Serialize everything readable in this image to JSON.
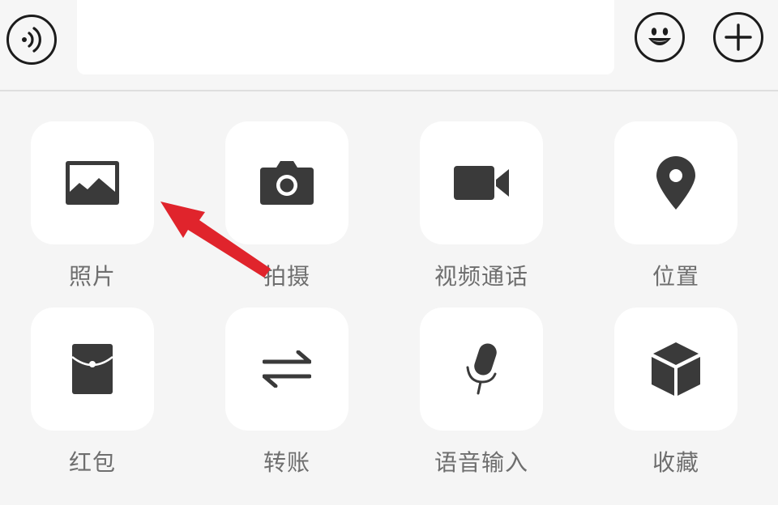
{
  "input_bar": {
    "voice_icon": "voice-icon",
    "text_value": "",
    "emoji_icon": "emoji-icon",
    "plus_icon": "plus-icon"
  },
  "panel": {
    "items": [
      {
        "label": "照片",
        "icon": "photo-icon"
      },
      {
        "label": "拍摄",
        "icon": "camera-icon"
      },
      {
        "label": "视频通话",
        "icon": "video-call-icon"
      },
      {
        "label": "位置",
        "icon": "location-icon"
      },
      {
        "label": "红包",
        "icon": "red-packet-icon"
      },
      {
        "label": "转账",
        "icon": "transfer-icon"
      },
      {
        "label": "语音输入",
        "icon": "microphone-icon"
      },
      {
        "label": "收藏",
        "icon": "favorites-icon"
      }
    ]
  },
  "colors": {
    "background": "#f5f5f5",
    "tile": "#ffffff",
    "icon": "#3a3a3a",
    "label": "#6e6e6e",
    "annotation_arrow": "#e0242c"
  }
}
